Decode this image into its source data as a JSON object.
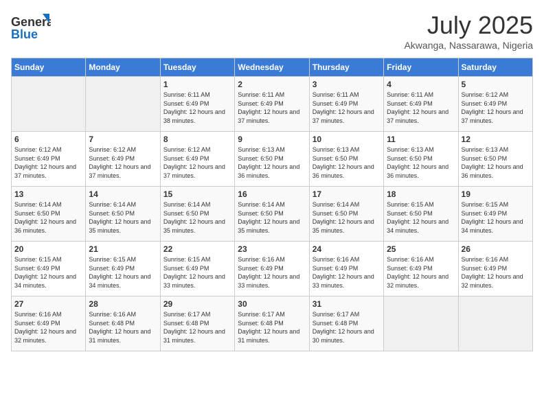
{
  "header": {
    "logo_general": "General",
    "logo_blue": "Blue",
    "month_year": "July 2025",
    "location": "Akwanga, Nassarawa, Nigeria"
  },
  "days_of_week": [
    "Sunday",
    "Monday",
    "Tuesday",
    "Wednesday",
    "Thursday",
    "Friday",
    "Saturday"
  ],
  "weeks": [
    [
      {
        "day": "",
        "info": ""
      },
      {
        "day": "",
        "info": ""
      },
      {
        "day": "1",
        "info": "Sunrise: 6:11 AM\nSunset: 6:49 PM\nDaylight: 12 hours and 38 minutes."
      },
      {
        "day": "2",
        "info": "Sunrise: 6:11 AM\nSunset: 6:49 PM\nDaylight: 12 hours and 37 minutes."
      },
      {
        "day": "3",
        "info": "Sunrise: 6:11 AM\nSunset: 6:49 PM\nDaylight: 12 hours and 37 minutes."
      },
      {
        "day": "4",
        "info": "Sunrise: 6:11 AM\nSunset: 6:49 PM\nDaylight: 12 hours and 37 minutes."
      },
      {
        "day": "5",
        "info": "Sunrise: 6:12 AM\nSunset: 6:49 PM\nDaylight: 12 hours and 37 minutes."
      }
    ],
    [
      {
        "day": "6",
        "info": "Sunrise: 6:12 AM\nSunset: 6:49 PM\nDaylight: 12 hours and 37 minutes."
      },
      {
        "day": "7",
        "info": "Sunrise: 6:12 AM\nSunset: 6:49 PM\nDaylight: 12 hours and 37 minutes."
      },
      {
        "day": "8",
        "info": "Sunrise: 6:12 AM\nSunset: 6:49 PM\nDaylight: 12 hours and 37 minutes."
      },
      {
        "day": "9",
        "info": "Sunrise: 6:13 AM\nSunset: 6:50 PM\nDaylight: 12 hours and 36 minutes."
      },
      {
        "day": "10",
        "info": "Sunrise: 6:13 AM\nSunset: 6:50 PM\nDaylight: 12 hours and 36 minutes."
      },
      {
        "day": "11",
        "info": "Sunrise: 6:13 AM\nSunset: 6:50 PM\nDaylight: 12 hours and 36 minutes."
      },
      {
        "day": "12",
        "info": "Sunrise: 6:13 AM\nSunset: 6:50 PM\nDaylight: 12 hours and 36 minutes."
      }
    ],
    [
      {
        "day": "13",
        "info": "Sunrise: 6:14 AM\nSunset: 6:50 PM\nDaylight: 12 hours and 36 minutes."
      },
      {
        "day": "14",
        "info": "Sunrise: 6:14 AM\nSunset: 6:50 PM\nDaylight: 12 hours and 35 minutes."
      },
      {
        "day": "15",
        "info": "Sunrise: 6:14 AM\nSunset: 6:50 PM\nDaylight: 12 hours and 35 minutes."
      },
      {
        "day": "16",
        "info": "Sunrise: 6:14 AM\nSunset: 6:50 PM\nDaylight: 12 hours and 35 minutes."
      },
      {
        "day": "17",
        "info": "Sunrise: 6:14 AM\nSunset: 6:50 PM\nDaylight: 12 hours and 35 minutes."
      },
      {
        "day": "18",
        "info": "Sunrise: 6:15 AM\nSunset: 6:50 PM\nDaylight: 12 hours and 34 minutes."
      },
      {
        "day": "19",
        "info": "Sunrise: 6:15 AM\nSunset: 6:49 PM\nDaylight: 12 hours and 34 minutes."
      }
    ],
    [
      {
        "day": "20",
        "info": "Sunrise: 6:15 AM\nSunset: 6:49 PM\nDaylight: 12 hours and 34 minutes."
      },
      {
        "day": "21",
        "info": "Sunrise: 6:15 AM\nSunset: 6:49 PM\nDaylight: 12 hours and 34 minutes."
      },
      {
        "day": "22",
        "info": "Sunrise: 6:15 AM\nSunset: 6:49 PM\nDaylight: 12 hours and 33 minutes."
      },
      {
        "day": "23",
        "info": "Sunrise: 6:16 AM\nSunset: 6:49 PM\nDaylight: 12 hours and 33 minutes."
      },
      {
        "day": "24",
        "info": "Sunrise: 6:16 AM\nSunset: 6:49 PM\nDaylight: 12 hours and 33 minutes."
      },
      {
        "day": "25",
        "info": "Sunrise: 6:16 AM\nSunset: 6:49 PM\nDaylight: 12 hours and 32 minutes."
      },
      {
        "day": "26",
        "info": "Sunrise: 6:16 AM\nSunset: 6:49 PM\nDaylight: 12 hours and 32 minutes."
      }
    ],
    [
      {
        "day": "27",
        "info": "Sunrise: 6:16 AM\nSunset: 6:49 PM\nDaylight: 12 hours and 32 minutes."
      },
      {
        "day": "28",
        "info": "Sunrise: 6:16 AM\nSunset: 6:48 PM\nDaylight: 12 hours and 31 minutes."
      },
      {
        "day": "29",
        "info": "Sunrise: 6:17 AM\nSunset: 6:48 PM\nDaylight: 12 hours and 31 minutes."
      },
      {
        "day": "30",
        "info": "Sunrise: 6:17 AM\nSunset: 6:48 PM\nDaylight: 12 hours and 31 minutes."
      },
      {
        "day": "31",
        "info": "Sunrise: 6:17 AM\nSunset: 6:48 PM\nDaylight: 12 hours and 30 minutes."
      },
      {
        "day": "",
        "info": ""
      },
      {
        "day": "",
        "info": ""
      }
    ]
  ]
}
